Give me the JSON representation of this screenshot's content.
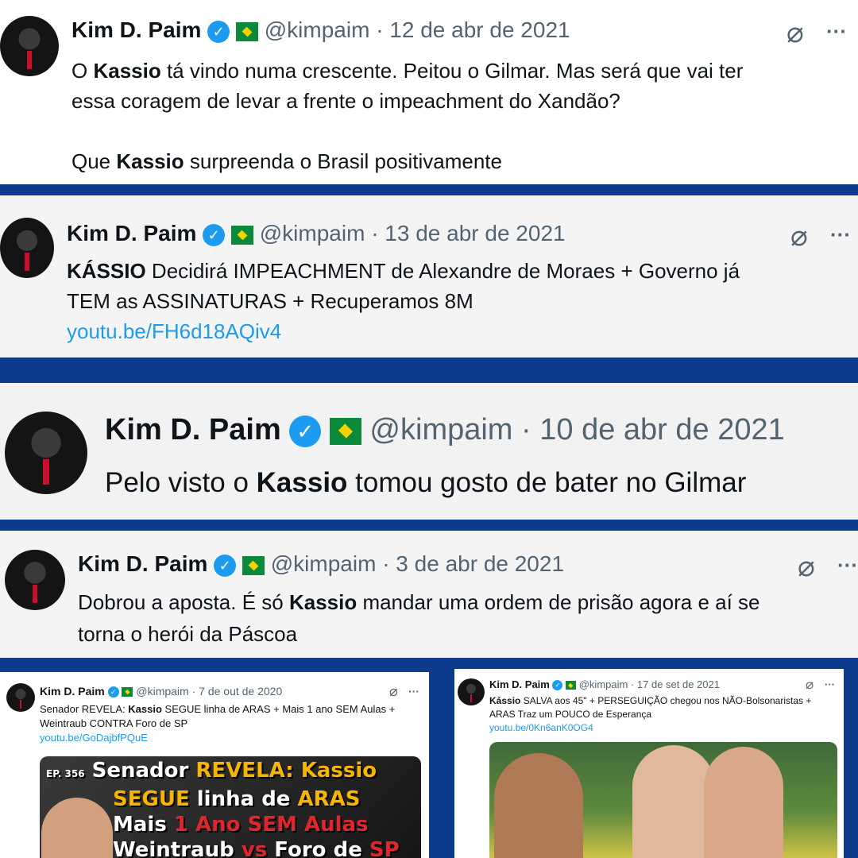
{
  "tweets": [
    {
      "name": "Kim D. Paim",
      "handle": "@kimpaim",
      "date": "· 12 de abr de 2021",
      "t1": "O ",
      "b1": "Kassio",
      "t2": " tá vindo numa crescente. Peitou o Gilmar. Mas será que vai ter",
      "t3": "essa coragem de levar a frente o impeachment do Xandão?",
      "t4": "Que ",
      "b2": "Kassio",
      "t5": " surpreenda o Brasil positivamente"
    },
    {
      "name": "Kim D. Paim",
      "handle": "@kimpaim",
      "date": "· 13 de abr de 2021",
      "b1": "KÁSSIO",
      "t1": " Decidirá IMPEACHMENT de Alexandre de Moraes + Governo já",
      "t2": "TEM as ASSINATURAS + Recuperamos 8M",
      "link": "youtu.be/FH6d18AQiv4"
    },
    {
      "name": "Kim D. Paim",
      "handle": "@kimpaim",
      "date": "· 10 de abr de 2021",
      "t1": "Pelo visto o ",
      "b1": "Kassio",
      "t2": " tomou gosto de bater no Gilmar"
    },
    {
      "name": "Kim D. Paim",
      "handle": "@kimpaim",
      "date": "· 3 de abr de 2021",
      "t1": "Dobrou a aposta. É só ",
      "b1": "Kassio",
      "t2": " mandar uma ordem de prisão agora e aí se",
      "t3": "torna o herói da Páscoa"
    },
    {
      "name": "Kim D. Paim",
      "handle": "@kimpaim",
      "date": "· 7 de out de 2020",
      "t1": "Senador REVELA: ",
      "b1": "Kassio",
      "t2": " SEGUE linha de ARAS  + Mais 1 ano SEM Aulas +",
      "t3": "Weintraub CONTRA Foro de SP",
      "link": "youtu.be/GoDajbfPQuE",
      "thumb": {
        "ep": "EP. 356",
        "l1a": "Senador ",
        "l1b": "REVELA: Kassio",
        "l2a": "SEGUE",
        "l2b": " linha de ",
        "l2c": "ARAS",
        "l3a": "Mais ",
        "l3b": "1 Ano SEM Aulas",
        "l4a": "Weintraub ",
        "l4b": "vs",
        "l4c": " Foro de ",
        "l4d": "SP"
      }
    },
    {
      "name": "Kim D. Paim",
      "handle": "@kimpaim",
      "date": "· 17 de set de 2021",
      "b1": "Kássio",
      "t1": " SALVA aos 45\" + PERSEGUIÇÃO chegou nos NÃO-Bolsonaristas +",
      "t2": "ARAS Traz um POUCO de Esperança",
      "link": "youtu.be/0Kn6anK0OG4"
    }
  ],
  "icons": {
    "verified": "verified-badge-icon",
    "flag": "flag-emoji-icon",
    "grok": "grok-icon",
    "more": "more-icon"
  },
  "glyphs": {
    "check": "✓",
    "grok": "⌀",
    "more": "···"
  },
  "colors": {
    "frame": "#0d3c8c",
    "link": "#1d9bf0",
    "handle": "#536471",
    "verified": "#1d9bf0"
  }
}
